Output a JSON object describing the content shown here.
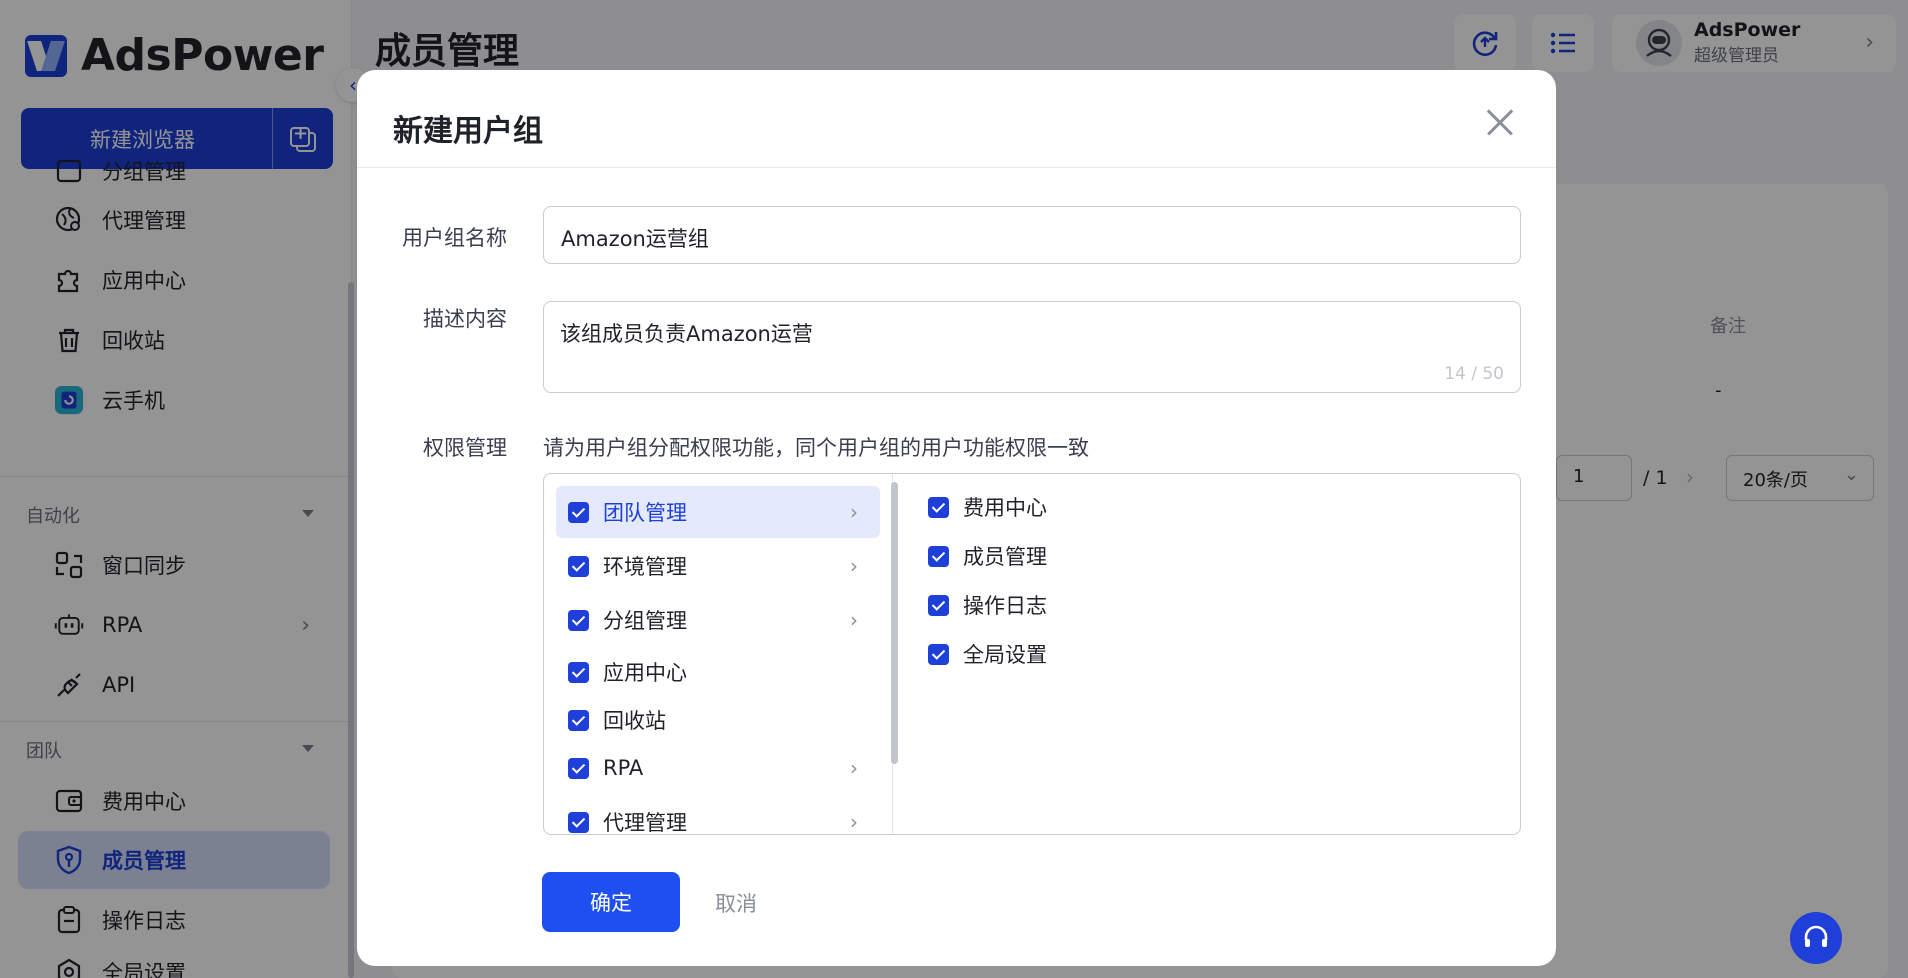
{
  "app": {
    "logo_text": "AdsPower",
    "brand_color": "#1e3fd8"
  },
  "sidebar": {
    "new_browser_label": "新建浏览器",
    "partial_item_label": "分组管理",
    "items_top": [
      {
        "label": "代理管理",
        "icon": "globe-pin-icon"
      },
      {
        "label": "应用中心",
        "icon": "puzzle-icon"
      },
      {
        "label": "回收站",
        "icon": "trash-icon"
      },
      {
        "label": "云手机",
        "icon": "cloud-phone-icon"
      }
    ],
    "section_automation": "自动化",
    "items_automation": [
      {
        "label": "窗口同步",
        "icon": "window-sync-icon"
      },
      {
        "label": "RPA",
        "icon": "robot-icon"
      },
      {
        "label": "API",
        "icon": "plug-icon"
      }
    ],
    "section_team": "团队",
    "items_team": [
      {
        "label": "费用中心",
        "icon": "wallet-icon"
      },
      {
        "label": "成员管理",
        "icon": "shield-user-icon"
      },
      {
        "label": "操作日志",
        "icon": "clipboard-icon"
      },
      {
        "label": "全局设置",
        "icon": "settings-icon"
      }
    ]
  },
  "header": {
    "page_title": "成员管理",
    "user_name": "AdsPower",
    "user_role": "超级管理员"
  },
  "background_table": {
    "column_note": "备注",
    "row_note_value": "-",
    "pager_current": "1",
    "pager_total": "/ 1",
    "page_size": "20条/页"
  },
  "modal": {
    "title": "新建用户组",
    "name_label": "用户组名称",
    "name_value": "Amazon运营组",
    "desc_label": "描述内容",
    "desc_value": "该组成员负责Amazon运营",
    "desc_counter": "14 / 50",
    "perm_label": "权限管理",
    "perm_hint": "请为用户组分配权限功能，同个用户组的用户功能权限一致",
    "perm_groups": [
      {
        "label": "团队管理",
        "checked": true,
        "has_children": true,
        "selected": true
      },
      {
        "label": "环境管理",
        "checked": true,
        "has_children": true
      },
      {
        "label": "分组管理",
        "checked": true,
        "has_children": true
      },
      {
        "label": "应用中心",
        "checked": true,
        "has_children": false
      },
      {
        "label": "回收站",
        "checked": true,
        "has_children": false
      },
      {
        "label": "RPA",
        "checked": true,
        "has_children": true
      },
      {
        "label": "代理管理",
        "checked": true,
        "has_children": true
      }
    ],
    "perm_children": [
      {
        "label": "费用中心",
        "checked": true
      },
      {
        "label": "成员管理",
        "checked": true
      },
      {
        "label": "操作日志",
        "checked": true
      },
      {
        "label": "全局设置",
        "checked": true
      }
    ],
    "confirm_label": "确定",
    "cancel_label": "取消"
  }
}
